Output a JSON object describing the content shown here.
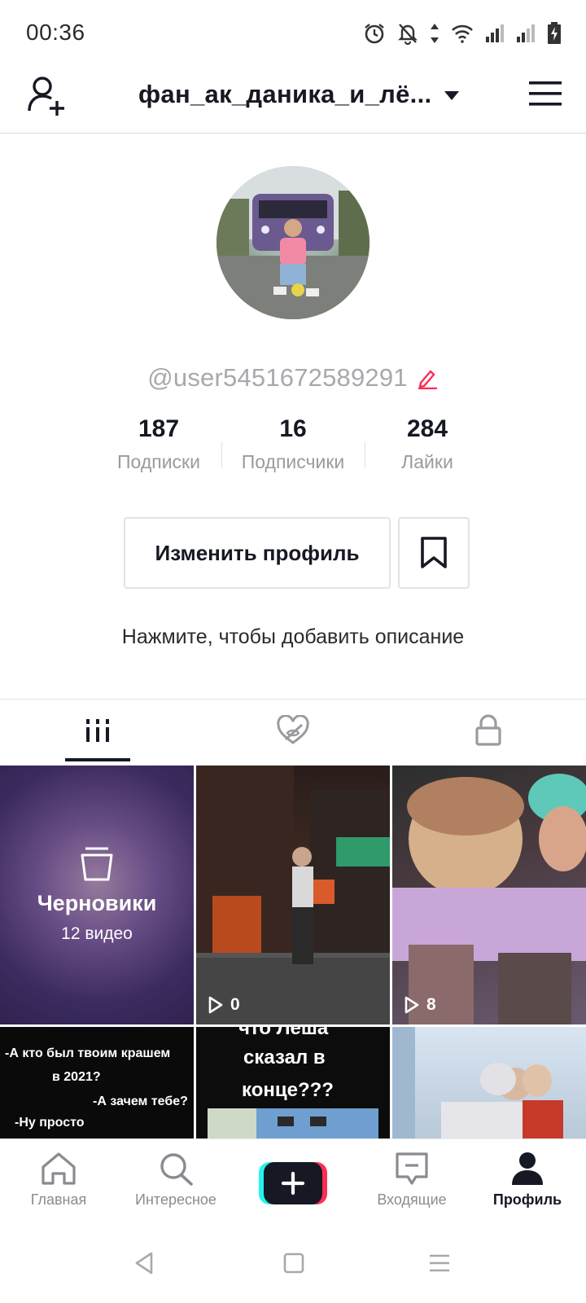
{
  "status_bar": {
    "time": "00:36",
    "icons": [
      "alarm-icon",
      "bell-off-icon",
      "data-arrows-icon",
      "wifi-icon",
      "signal-icon",
      "signal-icon",
      "battery-charging-icon"
    ]
  },
  "header": {
    "title": "фан_ак_даника_и_лё...",
    "left_icon": "add-user-icon",
    "right_icon": "menu-icon"
  },
  "profile": {
    "username": "@user5451672589291",
    "stats": [
      {
        "value": "187",
        "label": "Подписки"
      },
      {
        "value": "16",
        "label": "Подписчики"
      },
      {
        "value": "284",
        "label": "Лайки"
      }
    ],
    "edit_button": "Изменить профиль",
    "bio_placeholder": "Нажмите, чтобы добавить описание"
  },
  "tabs": [
    {
      "icon": "videos-grid-icon",
      "active": true
    },
    {
      "icon": "liked-hidden-icon",
      "active": false
    },
    {
      "icon": "lock-icon",
      "active": false
    }
  ],
  "grid": {
    "drafts": {
      "title": "Черновики",
      "count": "12 видео"
    },
    "videos": [
      {
        "plays": "0"
      },
      {
        "plays": "8"
      }
    ],
    "captions": {
      "tile4_lines": [
        "-А кто был твоим крашем",
        "в 2021?",
        "-А зачем тебе?",
        "-Ну просто"
      ],
      "tile5_lines": [
        "что Леша",
        "сказал в",
        "конце???"
      ]
    }
  },
  "bottom_nav": [
    {
      "label": "Главная",
      "icon": "home-icon"
    },
    {
      "label": "Интересное",
      "icon": "search-icon"
    },
    {
      "label": "",
      "icon": "plus-icon"
    },
    {
      "label": "Входящие",
      "icon": "inbox-icon"
    },
    {
      "label": "Профиль",
      "icon": "profile-icon"
    }
  ],
  "colors": {
    "accent_red": "#fe2c55",
    "accent_cyan": "#25f4ee",
    "text_primary": "#161823",
    "text_secondary": "#8a8b91"
  }
}
